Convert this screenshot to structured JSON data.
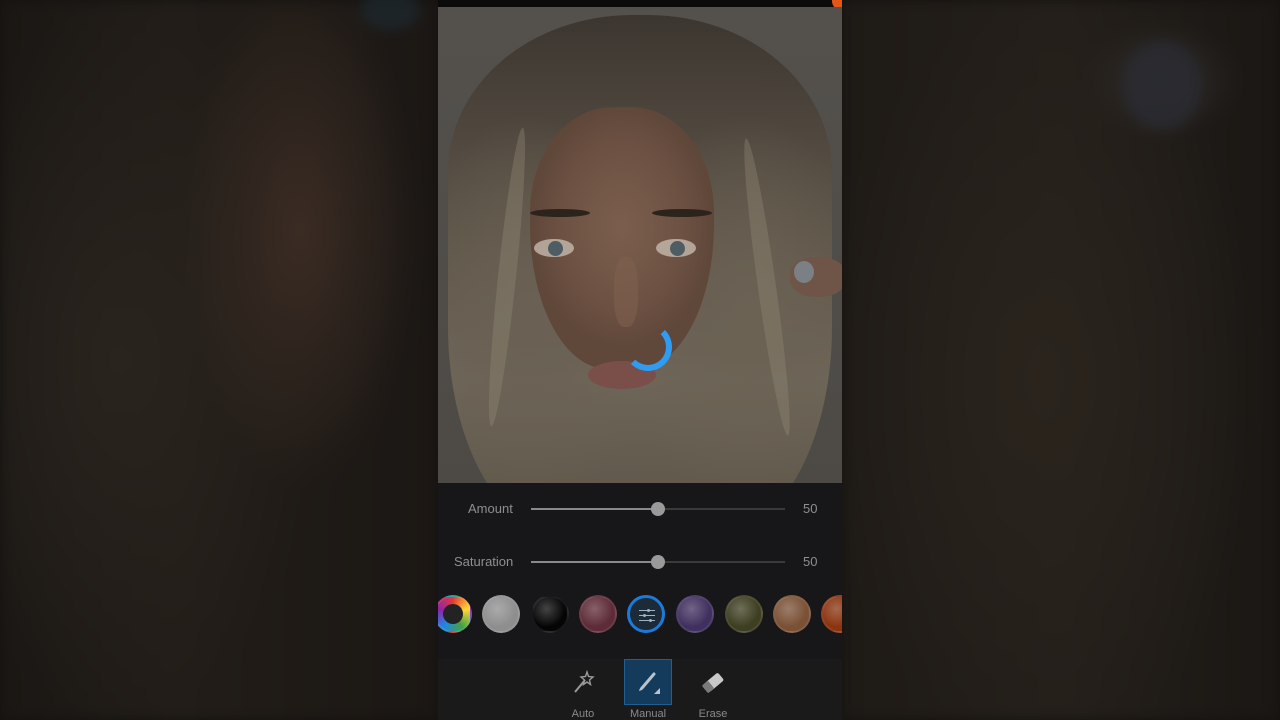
{
  "editor": {
    "sliders": [
      {
        "label": "Amount",
        "value": "50",
        "fraction": 0.5
      },
      {
        "label": "Saturation",
        "value": "50",
        "fraction": 0.5
      }
    ],
    "swatches": [
      {
        "name": "color-wheel",
        "color": "#2a2a2a"
      },
      {
        "name": "silver",
        "color": "#8e8e8e"
      },
      {
        "name": "black",
        "color": "#050505"
      },
      {
        "name": "rose",
        "color": "#5e2c38"
      },
      {
        "name": "adjust",
        "color": "#1d2a38"
      },
      {
        "name": "purple",
        "color": "#40305f"
      },
      {
        "name": "olive",
        "color": "#3e3e22"
      },
      {
        "name": "copper",
        "color": "#7a5136"
      },
      {
        "name": "orange",
        "color": "#8a3410"
      }
    ],
    "selected_swatch": "adjust",
    "tools": [
      {
        "label": "Auto",
        "icon": "magic-wand-icon"
      },
      {
        "label": "Manual",
        "icon": "brush-icon"
      },
      {
        "label": "Erase",
        "icon": "eraser-icon"
      }
    ],
    "active_tool": "Manual",
    "loading": true,
    "colors": {
      "accent": "#2f9cf4",
      "selected": "#1c7bd8"
    }
  }
}
